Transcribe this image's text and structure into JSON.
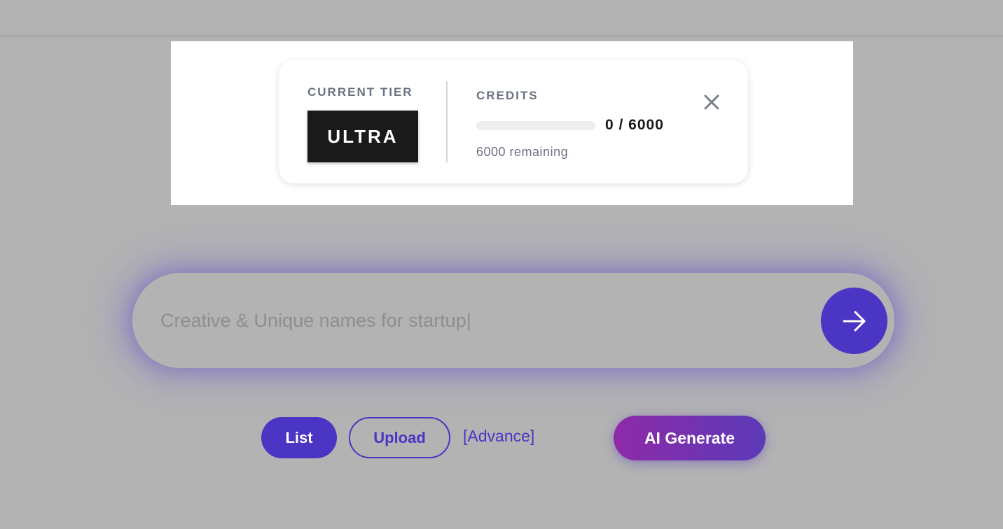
{
  "tier_popup": {
    "tier_label": "CURRENT TIER",
    "tier_name": "ULTRA",
    "credits_label": "CREDITS",
    "credits_used": 0,
    "credits_total": 6000,
    "credits_count_text": "0 / 6000",
    "credits_remaining_text": "6000 remaining",
    "progress_fraction": 0,
    "close_icon": "close-icon"
  },
  "search": {
    "placeholder": "Creative & Unique names for startup|",
    "value": "",
    "submit_icon": "arrow-right-icon"
  },
  "actions": {
    "list_label": "List",
    "upload_label": "Upload",
    "advance_label": "[Advance]",
    "ai_generate_label": "AI Generate"
  },
  "colors": {
    "accent": "#4a35c4",
    "overlay": "#b3b3b3",
    "tier_badge_bg": "#1a1a1a",
    "ai_gradient_start": "#8e2aa8",
    "ai_gradient_end": "#5b3ab8"
  }
}
